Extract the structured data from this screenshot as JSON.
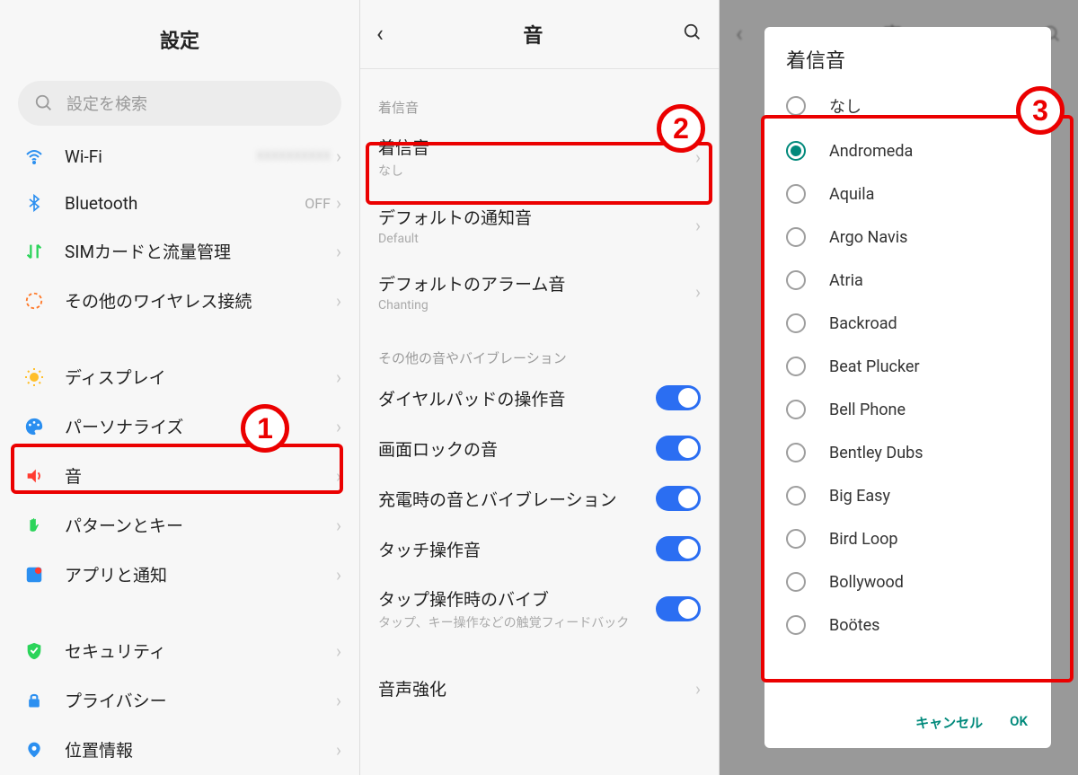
{
  "panel1": {
    "title": "設定",
    "search_placeholder": "設定を検索",
    "items": [
      {
        "icon": "wifi",
        "label": "Wi-Fi",
        "value_blurred": "XXXXXXXXXX"
      },
      {
        "icon": "bluetooth",
        "label": "Bluetooth",
        "value": "OFF"
      },
      {
        "icon": "sim",
        "label": "SIMカードと流量管理"
      },
      {
        "icon": "wireless",
        "label": "その他のワイヤレス接続"
      }
    ],
    "items2": [
      {
        "icon": "display",
        "label": "ディスプレイ"
      },
      {
        "icon": "personalize",
        "label": "パーソナライズ"
      },
      {
        "icon": "sound",
        "label": "音"
      },
      {
        "icon": "pattern",
        "label": "パターンとキー"
      },
      {
        "icon": "apps",
        "label": "アプリと通知"
      }
    ],
    "items3": [
      {
        "icon": "security",
        "label": "セキュリティ"
      },
      {
        "icon": "privacy",
        "label": "プライバシー"
      },
      {
        "icon": "location",
        "label": "位置情報"
      }
    ],
    "badge1": "1"
  },
  "panel2": {
    "title": "音",
    "section1": "着信音",
    "items1": [
      {
        "main": "着信音",
        "sub": "なし"
      },
      {
        "main": "デフォルトの通知音",
        "sub": "Default"
      },
      {
        "main": "デフォルトのアラーム音",
        "sub": "Chanting"
      }
    ],
    "section2": "その他の音やバイブレーション",
    "items2": [
      {
        "main": "ダイヤルパッドの操作音",
        "toggle": true
      },
      {
        "main": "画面ロックの音",
        "toggle": true
      },
      {
        "main": "充電時の音とバイブレーション",
        "toggle": true
      },
      {
        "main": "タッチ操作音",
        "toggle": true
      },
      {
        "main": "タップ操作時のバイブ",
        "sub": "タップ、キー操作などの触覚フィードバック",
        "toggle": true
      }
    ],
    "items3": [
      {
        "main": "音声強化"
      }
    ],
    "badge2": "2"
  },
  "panel3": {
    "dialog_title": "着信音",
    "options": [
      {
        "label": "なし",
        "selected": false
      },
      {
        "label": "Andromeda",
        "selected": true
      },
      {
        "label": "Aquila",
        "selected": false
      },
      {
        "label": "Argo Navis",
        "selected": false
      },
      {
        "label": "Atria",
        "selected": false
      },
      {
        "label": "Backroad",
        "selected": false
      },
      {
        "label": "Beat Plucker",
        "selected": false
      },
      {
        "label": "Bell Phone",
        "selected": false
      },
      {
        "label": "Bentley Dubs",
        "selected": false
      },
      {
        "label": "Big Easy",
        "selected": false
      },
      {
        "label": "Bird Loop",
        "selected": false
      },
      {
        "label": "Bollywood",
        "selected": false
      },
      {
        "label": "Boötes",
        "selected": false
      }
    ],
    "cancel": "キャンセル",
    "ok": "OK",
    "badge3": "3"
  },
  "icons": {
    "wifi_color": "#2b8ff0",
    "bluetooth_color": "#2b8ff0",
    "sim_color": "#2bd45a",
    "wireless_color": "#ff7a2b",
    "display_color": "#ffbf2b",
    "personalize_color": "#2b8ff0",
    "sound_color": "#ff3b30",
    "pattern_color": "#2bd45a",
    "apps_color": "#2b8ff0",
    "security_color": "#2bd45a",
    "privacy_color": "#2b8ff0",
    "location_color": "#2b8ff0"
  }
}
